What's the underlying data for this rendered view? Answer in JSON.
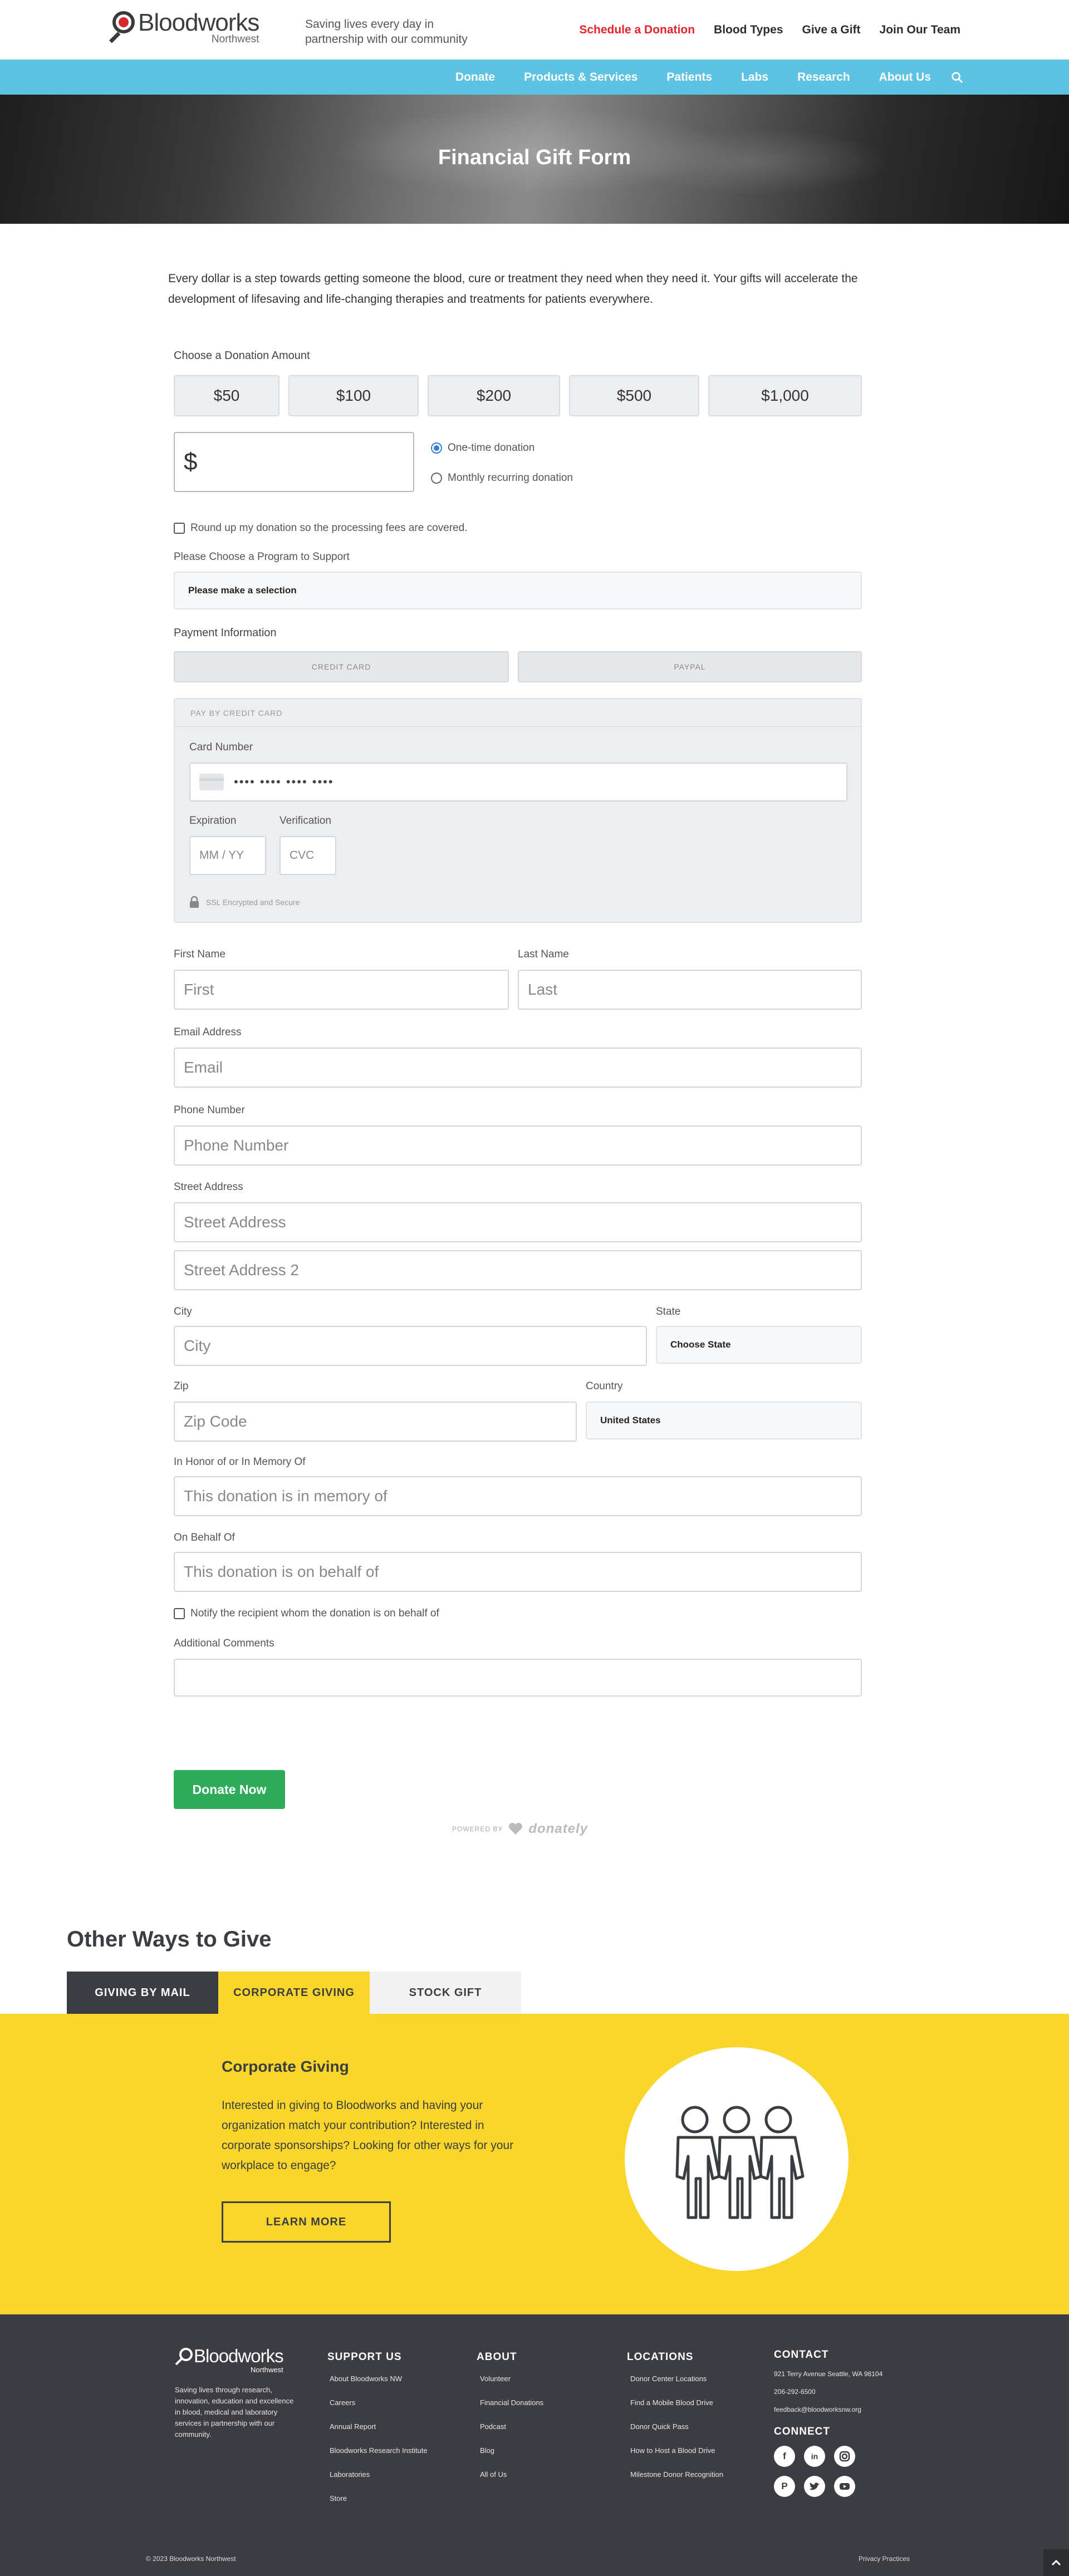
{
  "header": {
    "logo_name": "Bloodworks",
    "logo_sub": "Northwest",
    "tagline": "Saving lives every day in partnership with our community",
    "utility_nav": [
      "Schedule a Donation",
      "Blood Types",
      "Give a Gift",
      "Join Our Team"
    ],
    "main_nav": [
      "Donate",
      "Products & Services",
      "Patients",
      "Labs",
      "Research",
      "About Us"
    ]
  },
  "hero": {
    "title": "Financial Gift Form"
  },
  "intro": "Every dollar is a step towards getting someone the blood, cure or treatment they need when they need it. Your gifts will accelerate the development of lifesaving and life-changing therapies and treatments for patients everywhere.",
  "form": {
    "amount_label": "Choose a Donation Amount",
    "amounts": [
      "$50",
      "$100",
      "$200",
      "$500",
      "$1,000"
    ],
    "currency_symbol": "$",
    "frequency": [
      {
        "label": "One-time donation",
        "selected": true
      },
      {
        "label": "Monthly recurring donation",
        "selected": false
      }
    ],
    "roundup_label": "Round up my donation so the processing fees are covered.",
    "program_label": "Please Choose a Program to Support",
    "program_value": "Please make a selection",
    "payment_label": "Payment Information",
    "payment_tabs": [
      "CREDIT CARD",
      "PAYPAL"
    ],
    "cc": {
      "header": "PAY BY CREDIT CARD",
      "card_number_label": "Card Number",
      "card_number_placeholder": "•••• •••• •••• ••••",
      "expiration_label": "Expiration",
      "expiration_placeholder": "MM / YY",
      "verification_label": "Verification",
      "verification_placeholder": "CVC",
      "secure_note": "SSL Encrypted and Secure"
    },
    "first_name_label": "First Name",
    "first_name_ph": "First",
    "last_name_label": "Last Name",
    "last_name_ph": "Last",
    "email_label": "Email Address",
    "email_ph": "Email",
    "phone_label": "Phone Number",
    "phone_ph": "Phone Number",
    "street_label": "Street Address",
    "street_ph": "Street Address",
    "street2_ph": "Street Address 2",
    "city_label": "City",
    "city_ph": "City",
    "state_label": "State",
    "state_value": "Choose State",
    "zip_label": "Zip",
    "zip_ph": "Zip Code",
    "country_label": "Country",
    "country_value": "United States",
    "honor_label": "In Honor of or In Memory Of",
    "honor_ph": "This donation is in memory of",
    "behalf_label": "On Behalf Of",
    "behalf_ph": "This donation is on behalf of",
    "notify_label": "Notify the recipient whom the donation is on behalf of",
    "comments_label": "Additional Comments",
    "submit_label": "Donate Now",
    "powered_by": "POWERED BY",
    "powered_brand": "donately"
  },
  "other_ways": {
    "title": "Other Ways to Give",
    "tabs": [
      "GIVING BY MAIL",
      "CORPORATE GIVING",
      "STOCK GIFT"
    ],
    "active_tab": "CORPORATE GIVING",
    "panel_title": "Corporate Giving",
    "panel_body": "Interested in giving to Bloodworks and having your organization match your contribution? Interested in corporate sponsorships? Looking for other ways for your workplace to engage?",
    "panel_button": "LEARN MORE"
  },
  "footer": {
    "logo_name": "Bloodworks",
    "logo_sub": "Northwest",
    "about_text": "Saving lives through research, innovation, education and excellence in blood, medical and laboratory services in partnership with our community.",
    "support": {
      "title": "SUPPORT US",
      "links": [
        "About Bloodworks NW",
        "Careers",
        "Annual Report",
        "Bloodworks Research Institute",
        "Laboratories",
        "Store"
      ]
    },
    "about": {
      "title": "ABOUT",
      "links": [
        "Volunteer",
        "Financial Donations",
        "Podcast",
        "Blog",
        "All of Us"
      ]
    },
    "locations": {
      "title": "LOCATIONS",
      "links": [
        "Donor Center Locations",
        "Find a Mobile Blood Drive",
        "Donor Quick Pass",
        "How to Host a Blood Drive",
        "Milestone Donor Recognition"
      ]
    },
    "contact": {
      "title": "CONTACT",
      "address": "921 Terry Avenue Seattle, WA 98104",
      "phone": "206-292-6500",
      "email": "feedback@bloodworksnw.org"
    },
    "connect_title": "CONNECT",
    "social_icons": [
      "facebook-icon",
      "linkedin-icon",
      "instagram-icon",
      "pinterest-icon",
      "twitter-icon",
      "youtube-icon"
    ],
    "copyright": "© 2023 Bloodworks Northwest",
    "privacy": "Privacy Practices"
  },
  "colors": {
    "accent_red": "#e4232d",
    "nav_blue": "#5ec2e2",
    "donate_green": "#2eab5b",
    "yellow": "#fbd62a",
    "footer_dark": "#3b3d42"
  }
}
